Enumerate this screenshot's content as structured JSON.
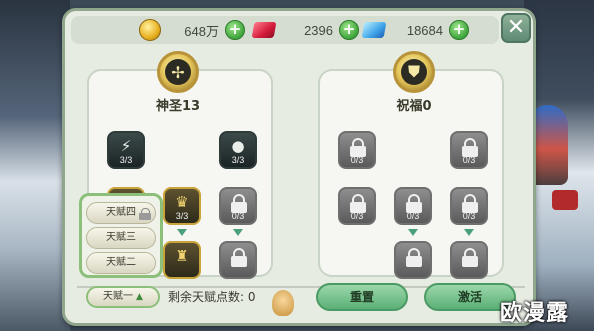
{
  "resources": {
    "gold": {
      "value": "648万",
      "icon": "gold-coin-icon"
    },
    "ruby": {
      "value": "2396",
      "icon": "ruby-gem-icon"
    },
    "diamond": {
      "value": "18684",
      "icon": "diamond-gem-icon"
    },
    "plus_label": "+"
  },
  "close_label": "✕",
  "trees": {
    "left": {
      "title": "神圣13",
      "emblem_icon": "holy-cross-icon",
      "nodes": [
        {
          "state": "active",
          "count": "3/3",
          "icon": "shield-bolt-icon"
        },
        {
          "state": "active",
          "count": "3/3",
          "icon": "shadow-figure-icon"
        },
        {
          "state": "gold",
          "count": "",
          "icon": "gold-figure-icon"
        },
        {
          "state": "gold",
          "count": "3/3",
          "icon": "winged-figure-icon"
        },
        {
          "state": "locked",
          "count": "0/3",
          "icon": "lock-icon"
        },
        {
          "state": "gold",
          "count": "",
          "icon": "gold-beast-icon"
        },
        {
          "state": "locked",
          "count": "",
          "icon": "lock-icon"
        }
      ]
    },
    "right": {
      "title": "祝福0",
      "emblem_icon": "blessing-shield-icon",
      "nodes": [
        {
          "state": "locked",
          "count": "0/3"
        },
        {
          "state": "locked",
          "count": "0/3"
        },
        {
          "state": "locked",
          "count": "0/3"
        },
        {
          "state": "locked",
          "count": "0/3"
        },
        {
          "state": "locked",
          "count": "0/3"
        },
        {
          "state": "locked",
          "count": ""
        },
        {
          "state": "locked",
          "count": ""
        }
      ]
    }
  },
  "talent_pages": {
    "options": [
      "天赋四",
      "天赋三",
      "天赋二"
    ],
    "current": "天赋一",
    "current_indicator": "▲"
  },
  "remaining_points_label": "剩余天赋点数: 0",
  "buttons": {
    "reset": "重置",
    "activate": "激活"
  },
  "watermark": "欧漫露"
}
